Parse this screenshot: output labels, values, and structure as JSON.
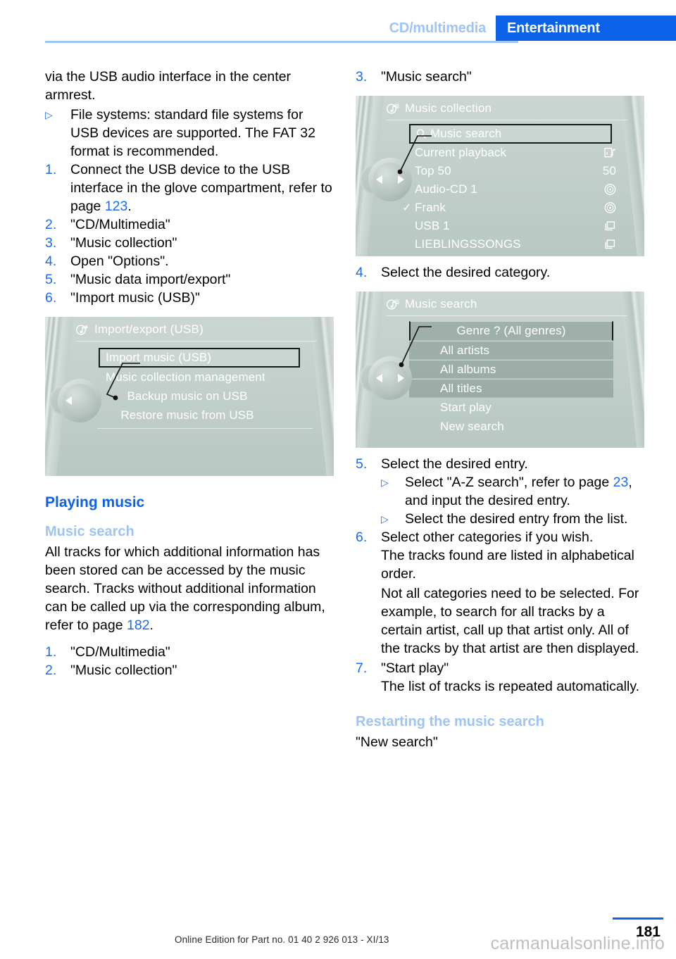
{
  "header": {
    "breadcrumb_inactive": "CD/multimedia",
    "breadcrumb_active": "Entertainment",
    "accent_color": "#0b62e8",
    "light_blue": "#9ec4f5"
  },
  "left_column": {
    "intro_paragraph": "via the USB audio interface in the center armrest.",
    "bullet_1": {
      "marker": "▷",
      "text": "File systems: standard file systems for USB devices are supported. The FAT 32 format is recommended."
    },
    "steps": [
      {
        "marker": "1.",
        "text_before": "Connect the USB device to the USB interface in the glove compartment, refer to page ",
        "pageref": "123",
        "text_after": "."
      },
      {
        "marker": "2.",
        "text_before": "\"CD/Multimedia\"",
        "pageref": "",
        "text_after": ""
      },
      {
        "marker": "3.",
        "text_before": "\"Music collection\"",
        "pageref": "",
        "text_after": ""
      },
      {
        "marker": "4.",
        "text_before": "Open \"Options\".",
        "pageref": "",
        "text_after": ""
      },
      {
        "marker": "5.",
        "text_before": "\"Music data import/export\"",
        "pageref": "",
        "text_after": ""
      },
      {
        "marker": "6.",
        "text_before": "\"Import music (USB)\"",
        "pageref": "",
        "text_after": ""
      }
    ],
    "section_heading": "Playing music",
    "sub_heading": "Music search",
    "body_paragraph_before": "All tracks for which additional information has been stored can be accessed by the music search. Tracks without additional information can be called up via the corresponding album, refer to page ",
    "body_paragraph_pageref": "182",
    "body_paragraph_after": ".",
    "steps2": [
      {
        "marker": "1.",
        "text": "\"CD/Multimedia\""
      },
      {
        "marker": "2.",
        "text": "\"Music collection\""
      }
    ]
  },
  "right_column": {
    "step3": {
      "marker": "3.",
      "text": "\"Music search\""
    },
    "step4": {
      "marker": "4.",
      "text": "Select the desired category."
    },
    "step5": {
      "marker": "5.",
      "text": "Select the desired entry."
    },
    "step5_sub1": {
      "marker": "▷",
      "text_before": "Select \"A-Z search\", refer to page ",
      "pageref": "23",
      "text_after": ", and input the desired entry."
    },
    "step5_sub2": {
      "marker": "▷",
      "text": "Select the desired entry from the list."
    },
    "step6": {
      "marker": "6.",
      "text": "Select other categories if you wish."
    },
    "step6_note1": "The tracks found are listed in alphabetical order.",
    "step6_note2": "Not all categories need to be selected. For example, to search for all tracks by a certain artist, call up that artist only. All of the tracks by that artist are then displayed.",
    "step7": {
      "marker": "7.",
      "text": "\"Start play\""
    },
    "step7_note": "The list of tracks is repeated automatically.",
    "restart_heading": "Restarting the music search",
    "restart_text": "\"New search\""
  },
  "screens": {
    "import_export": {
      "title": "Import/export (USB)",
      "title_icon": "music-note-plus-icon",
      "knob_icon_left": "triangle-left-icon",
      "items": [
        {
          "label": "Import music (USB)",
          "selected": true,
          "align": "left"
        },
        {
          "label": "Music collection management",
          "selected": false,
          "align": "left"
        },
        {
          "label": "Backup music on USB",
          "selected": false,
          "align": "center"
        },
        {
          "label": "Restore music from USB",
          "selected": false,
          "align": "center"
        }
      ]
    },
    "music_collection": {
      "title": "Music collection",
      "title_icon": "music-note-list-icon",
      "knob_icon_left": "triangle-left-icon",
      "knob_icon_right": "triangle-right-icon",
      "items": [
        {
          "label": "Music search",
          "selected": true,
          "lead_icon": "search-icon",
          "right": "",
          "right_icon": ""
        },
        {
          "label": "Current playback",
          "selected": false,
          "lead_icon": "",
          "right": "",
          "right_icon": "info-music-icon"
        },
        {
          "label": "Top 50",
          "selected": false,
          "lead_icon": "",
          "right": "50",
          "right_icon": ""
        },
        {
          "label": "Audio-CD 1",
          "selected": false,
          "lead_icon": "",
          "right": "",
          "right_icon": "disc-icon"
        },
        {
          "label": "Frank",
          "selected": false,
          "lead_icon": "check-icon",
          "right": "",
          "right_icon": "disc-icon"
        },
        {
          "label": "USB 1",
          "selected": false,
          "lead_icon": "",
          "right": "",
          "right_icon": "folder-icon"
        },
        {
          "label": "LIEBLINGSSONGS",
          "selected": false,
          "lead_icon": "",
          "right": "",
          "right_icon": "folder-icon"
        }
      ]
    },
    "music_search": {
      "title": "Music search",
      "title_icon": "music-note-list-icon",
      "knob_icon_left": "triangle-left-icon",
      "knob_icon_right": "triangle-right-icon",
      "items": [
        {
          "label": "Genre ?  (All genres)",
          "selected": true,
          "bar": true
        },
        {
          "label": "All artists",
          "selected": false,
          "bar": true
        },
        {
          "label": "All albums",
          "selected": false,
          "bar": true
        },
        {
          "label": "All titles",
          "selected": false,
          "bar": true
        },
        {
          "label": "Start play",
          "selected": false,
          "bar": false
        },
        {
          "label": "New search",
          "selected": false,
          "bar": false
        }
      ]
    }
  },
  "footer": {
    "edition_note": "Online Edition for Part no. 01 40 2 926 013 - XI/13",
    "page_number": "181",
    "watermark": "carmanualsonline.info"
  }
}
